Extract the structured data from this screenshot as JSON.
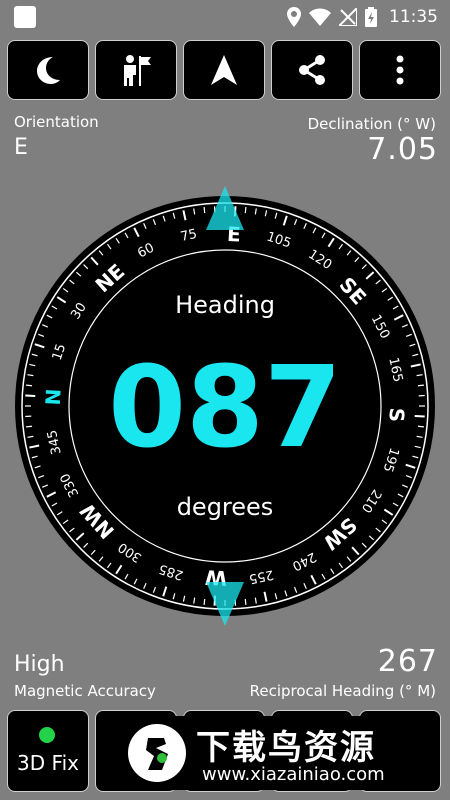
{
  "status_bar": {
    "time": "11:35",
    "icons": [
      "location-icon",
      "wifi-icon",
      "no-signal-icon",
      "battery-charging-icon"
    ]
  },
  "toolbar": {
    "buttons": [
      {
        "name": "night-mode-button",
        "icon": "moon-icon"
      },
      {
        "name": "direction-marker-button",
        "icon": "person-flag-icon"
      },
      {
        "name": "navigate-button",
        "icon": "navigation-arrow-icon"
      },
      {
        "name": "share-button",
        "icon": "share-icon"
      },
      {
        "name": "more-options-button",
        "icon": "overflow-menu-icon"
      }
    ]
  },
  "orientation": {
    "label": "Orientation",
    "value": "E"
  },
  "declination": {
    "label": "Declination (° W)",
    "value": "7.05"
  },
  "compass": {
    "heading_label": "Heading",
    "heading_value": "087",
    "unit_label": "degrees",
    "current_heading_deg": 87,
    "cardinals": [
      "N",
      "NE",
      "E",
      "SE",
      "S",
      "SW",
      "W",
      "NW"
    ],
    "degree_labels": [
      "15",
      "30",
      "60",
      "75",
      "105",
      "120",
      "150",
      "165",
      "195",
      "210",
      "240",
      "255",
      "285",
      "300",
      "330",
      "345"
    ],
    "accent_color": "#19e6ef",
    "cardinal_N_color": "#19e6ef"
  },
  "accuracy": {
    "value": "High",
    "label": "Magnetic Accuracy"
  },
  "reciprocal": {
    "value": "267",
    "label": "Reciprocal Heading (° M)"
  },
  "bottom_bar": {
    "fix_label": "3D Fix",
    "fix_color": "#22d34a"
  },
  "watermark": {
    "title": "下载鸟资源",
    "url": "www.xiazainiao.com"
  }
}
